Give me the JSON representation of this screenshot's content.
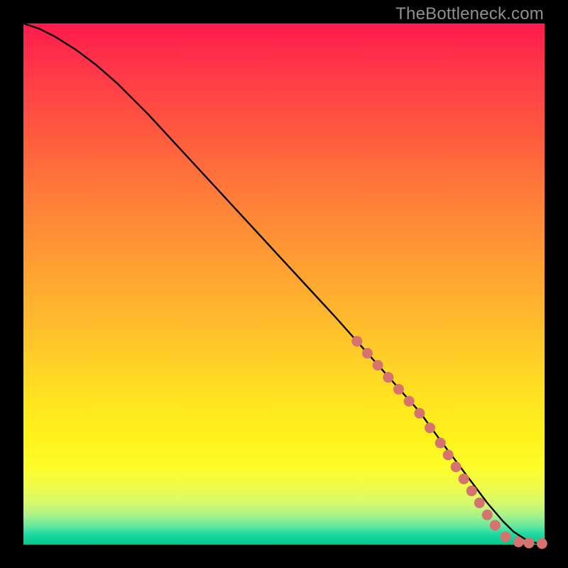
{
  "watermark": "TheBottleneck.com",
  "colors": {
    "line": "#000000",
    "marker": "#d6736e",
    "background_border": "#000000"
  },
  "chart_data": {
    "type": "line",
    "title": "",
    "xlabel": "",
    "ylabel": "",
    "xlim": [
      0,
      100
    ],
    "ylim": [
      0,
      100
    ],
    "grid": false,
    "legend": false,
    "note": "No axis ticks or labels are rendered; values are proportional estimates read from pixel positions (0–100 on each axis, y increases upward).",
    "series": [
      {
        "name": "curve",
        "style": "solid-black-line",
        "x": [
          0,
          3,
          6,
          10,
          14,
          18,
          24,
          30,
          36,
          42,
          48,
          54,
          60,
          64,
          68,
          72,
          76,
          80,
          83,
          86,
          89,
          92,
          94,
          96,
          98,
          100
        ],
        "y": [
          100,
          99,
          97.5,
          95,
          92,
          88.5,
          82.5,
          76,
          69.5,
          63,
          56.5,
          50,
          43.5,
          39,
          34.5,
          30,
          25.5,
          20,
          16,
          12,
          8,
          4.5,
          2.5,
          1.2,
          0.4,
          0
        ]
      },
      {
        "name": "dotted-segment",
        "style": "salmon-dots",
        "description": "fat salmon dots overlaid on the lower-right portion of the curve, becoming a near-flat tail at y≈0",
        "x": [
          64,
          66,
          68,
          70,
          72,
          74,
          76,
          78,
          80,
          81.5,
          83,
          84.5,
          86,
          87.5,
          89,
          90.5,
          92.5,
          95,
          97,
          99.5
        ],
        "y": [
          39,
          36.7,
          34.4,
          32.1,
          29.8,
          27.5,
          25.2,
          22.4,
          19.5,
          17.2,
          14.9,
          12.6,
          10.3,
          8.0,
          5.7,
          3.7,
          1.5,
          0.5,
          0.3,
          0.2
        ]
      }
    ]
  }
}
